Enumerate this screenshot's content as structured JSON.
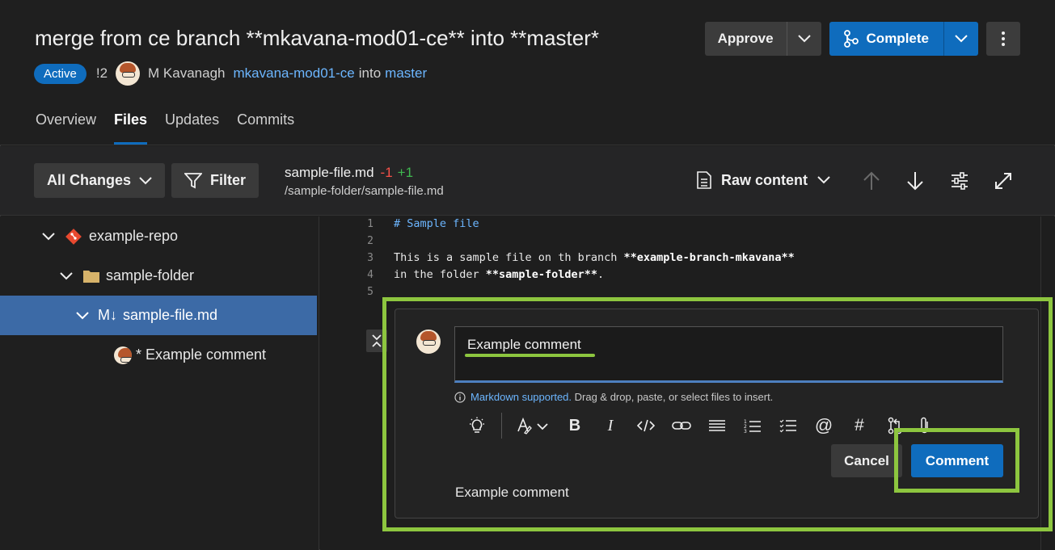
{
  "header": {
    "title": "merge from ce branch **mkavana-mod01-ce** into **master*",
    "status": "Active",
    "pr_ref": "!2",
    "author": "M Kavanagh",
    "source_branch": "mkavana-mod01-ce",
    "into": "into",
    "target_branch": "master",
    "approve_label": "Approve",
    "complete_label": "Complete",
    "more_icon": "more-vertical-icon"
  },
  "tabs": [
    {
      "label": "Overview"
    },
    {
      "label": "Files",
      "active": true
    },
    {
      "label": "Updates"
    },
    {
      "label": "Commits"
    }
  ],
  "toolbar": {
    "all_changes_label": "All Changes",
    "filter_label": "Filter",
    "file_name": "sample-file.md",
    "deletions": "-1",
    "additions": "+1",
    "file_path": "/sample-folder/sample-file.md",
    "raw_content_label": "Raw content"
  },
  "tree": {
    "repo": "example-repo",
    "folder": "sample-folder",
    "file_prefix": "M↓",
    "file": "sample-file.md",
    "comment": "* Example comment"
  },
  "code": {
    "line_numbers": [
      "1",
      "2",
      "3",
      "4",
      "5"
    ],
    "line1": "# Sample file",
    "line3_text": "This is a sample file on th branch ",
    "line3_bold": "**example-branch-mkavana**",
    "line4_text": "in the folder ",
    "line4_bold": "**sample-folder**",
    "line4_end": "."
  },
  "comment_box": {
    "input_value": "Example comment",
    "hint_link": "Markdown supported.",
    "hint_text": " Drag & drop, paste, or select files to insert.",
    "cancel_label": "Cancel",
    "comment_label": "Comment",
    "preview": "Example comment"
  },
  "colors": {
    "accent": "#0f6cbd",
    "highlight": "#8dc63f",
    "deletions": "#f85149",
    "additions": "#3fb950"
  }
}
